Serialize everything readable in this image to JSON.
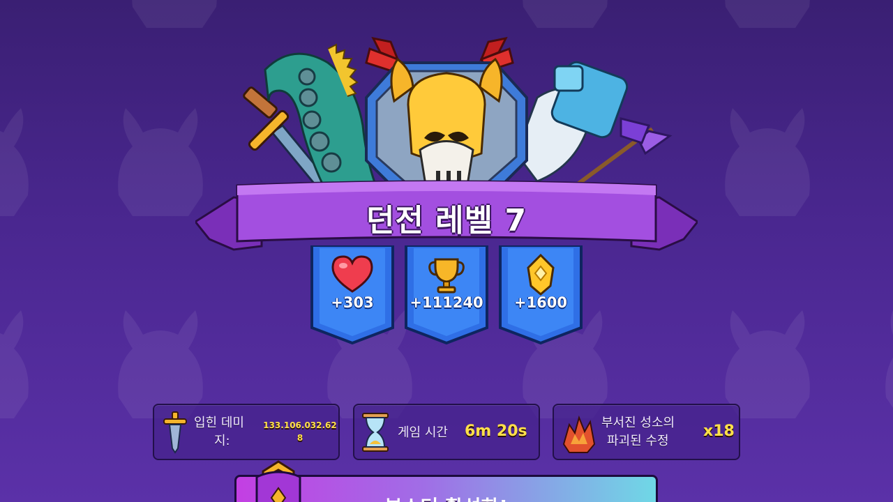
{
  "dungeon": {
    "title": "던전 레벨 7"
  },
  "rewards": [
    {
      "icon": "heart-icon",
      "value": "+303"
    },
    {
      "icon": "trophy-icon",
      "value": "+111240"
    },
    {
      "icon": "gem-icon",
      "value": "+1600"
    }
  ],
  "stats": {
    "damage": {
      "label_line1": "입힌 데미",
      "label_line2": "지:",
      "value_line1": "133.106.032.62",
      "value_line2": "8"
    },
    "time": {
      "label": "게임 시간",
      "value": "6m 20s"
    },
    "crystals": {
      "label_line1": "부서진 성소의",
      "label_line2": "파괴된 수정",
      "value": "x18"
    }
  },
  "boost": {
    "label": "부스터 활성화!"
  },
  "colors": {
    "background": "#4a2790",
    "ribbon": "#a34fe0",
    "banner_blue": "#2f6fe6",
    "value_yellow": "#ffe04a",
    "boost_start": "#c33fe3",
    "boost_end": "#6fd8e6"
  }
}
